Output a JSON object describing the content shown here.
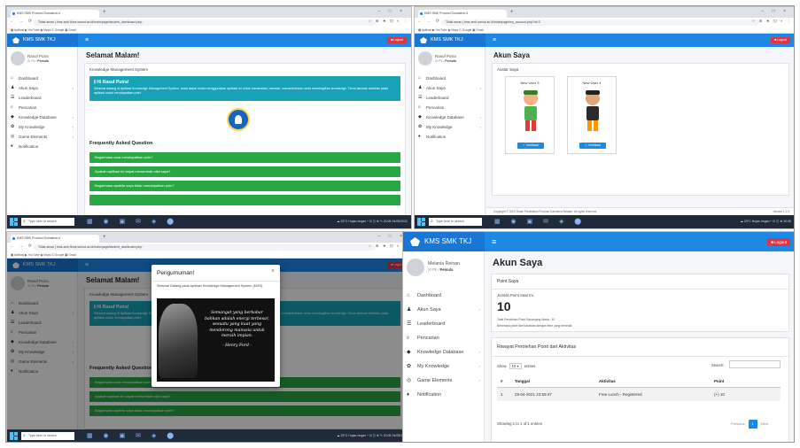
{
  "colors": {
    "primary": "#1e88e5",
    "info": "#17a2b8",
    "success": "#28a745",
    "danger": "#dc3545"
  },
  "browser": {
    "tab_title": "KMS SMK Provinsi Sumatera U",
    "new_tab": "+",
    "win_buttons": "–  □  ×",
    "nav_icons": "←  →  ⟳",
    "url_p1": "Tidak aman | kms-smk.fkms.sumut.ac.id/main/page/student_dashboard.php",
    "url_p2": "Tidak aman | kms-smk.sumut.ac.id/main/page/my_account.php?id=3",
    "url_p3": "Tidak aman | kms-smk.fkms.sumut.ac.id/main/page/student_dashboard.php",
    "ext_icons": "☆ ⊕ ★ ⊡ ◐ ⋮",
    "bookmarks": "▦ Aplikasi   ▶ YouTube   ◉ Maps   G Google   ▣ Gmail"
  },
  "app": {
    "brand": "KMS SMK TKJ",
    "hamburger": "≡",
    "logout": "■ Logout",
    "user_name_a": "Rasuf Putra",
    "user_name_b": "Melania Reinan",
    "role_prefix": "XI Pk /",
    "role": "Pemula",
    "nav": [
      {
        "icon": "⌂",
        "label": "Dashboard",
        "chev": ""
      },
      {
        "icon": "♟",
        "label": "Akun Saya",
        "chev": "‹"
      },
      {
        "icon": "☰",
        "label": "Leaderboard",
        "chev": ""
      },
      {
        "icon": "⌕",
        "label": "Pencarian",
        "chev": ""
      },
      {
        "icon": "◆",
        "label": "Knowledge Database",
        "chev": "‹"
      },
      {
        "icon": "✿",
        "label": "My Knowledge",
        "chev": "‹"
      },
      {
        "icon": "◎",
        "label": "Game Elements",
        "chev": "‹"
      },
      {
        "icon": "♦",
        "label": "Notification",
        "chev": ""
      }
    ]
  },
  "dashboard": {
    "title": "Selamat Malam!",
    "subtitle": "Knowledge Management System",
    "alert_title": "ℹ Hi Rasuf Putra!",
    "alert_body": "Selamat datang di Aplikasi Knowledge Management System, anda dapat mulai menggunakan aplikasi ini untuk menambah, mencari, menambahkan serta membagikan knowledge. Terus lakukan aktivitas pada aplikasi untuk mendapatkan poin!",
    "faq_title": "Frequently Asked Question",
    "faqs": [
      "Bagaimana cara mendapatkan poin?",
      "Apakah aplikasi ini dapat menambah nilai saya?",
      "Bagaimana apabila saya tidak mendapatkan poin?"
    ]
  },
  "account": {
    "title": "Akun Saya",
    "avatar_header": "Avatar Saya",
    "cards": [
      {
        "label": "New User 3",
        "button": "✓ Verifikasi"
      },
      {
        "label": "New User 4",
        "button": "✓ Verifikasi"
      }
    ],
    "footer": "Copyright © 2022 Dinas Pendidikan Provinsi Sumatera Selatan. All rights reserved.",
    "version": "Version 1.1.0"
  },
  "modal": {
    "title": "Pengumuman!",
    "close": "×",
    "body": "Selamat Datang pada Aplikasi Knowledge Management System (KMS).",
    "quote": "Semangat yang berkobar bahkan adalah energi terbesar, sesuatu yang kuat yang mendorong manusia untuk meraih impian.",
    "quote_author": "- Henry Ford -"
  },
  "points": {
    "title": "Akun Saya",
    "box_title": "Point Saya",
    "total_label": "Jumlah Point Saat Ini:",
    "total_value": "10",
    "note1": "Total Perolehan Point Sepanjang Masa : 10",
    "note2": "Beberapa point dan tukarkan dengan item yang tersedia",
    "history_title": "Riwayat Perolehan Point dari Aktivitas",
    "show": "Show",
    "show_value": "10 ▾",
    "entries": "entries",
    "search": "Search:",
    "columns": [
      "#",
      "Tanggal",
      "Aktivitas",
      "Point"
    ],
    "rows": [
      {
        "no": "1",
        "date": "29-04-2021 23:59:47",
        "activity": "Free Lunch - Registered",
        "point": "(+) 10"
      }
    ],
    "info": "Showing 1 to 1 of 1 entries",
    "prev": "Previous",
    "page": "1",
    "next": "Next"
  },
  "taskbar": {
    "search": "Type here to search",
    "apps": "▦ ◉ ▣ ✉ ◈ ⬤",
    "tray_p1": "☁ 25°C  Hujan ringan  ^  ⊡  ◫  ⊕  ✎   20:05  24/05/2021",
    "tray_p2": "☁ 25°C  Hujan ringan  ^  ⊡  ◫  ⊕   20:05",
    "tray_p3": "☁ 25°C  Hujan ringan  ^  ⊡  ◫  ⊕  ✎   20:05  24/05/2021"
  }
}
